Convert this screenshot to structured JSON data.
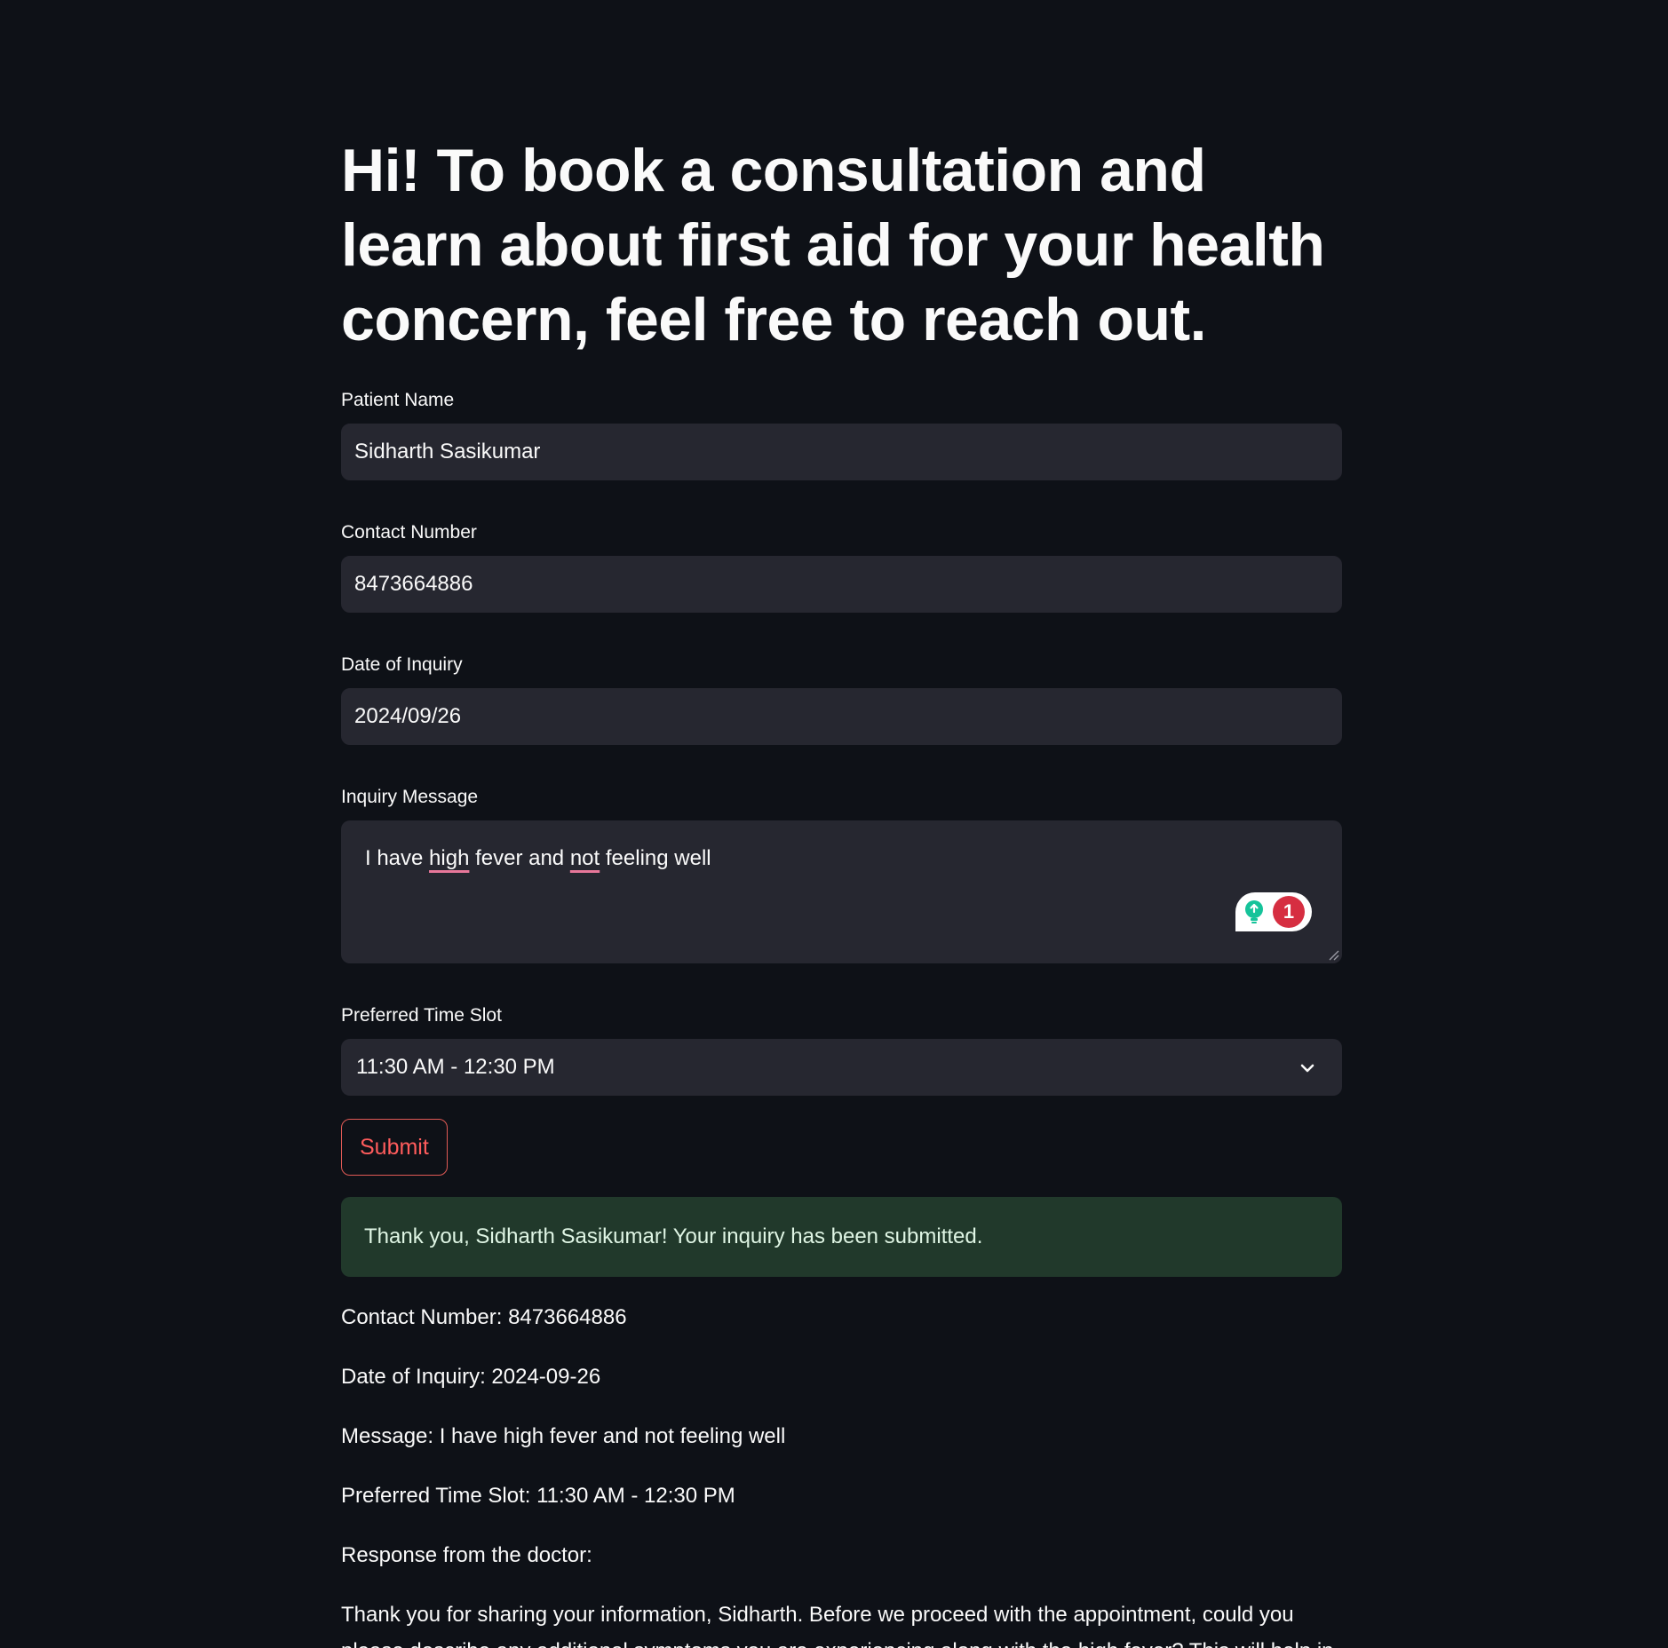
{
  "header": {
    "title": "Hi! To book a consultation and learn about first aid for your health concern, feel free to reach out."
  },
  "form": {
    "patient_name": {
      "label": "Patient Name",
      "value": "Sidharth Sasikumar"
    },
    "contact_number": {
      "label": "Contact Number",
      "value": "8473664886"
    },
    "date_of_inquiry": {
      "label": "Date of Inquiry",
      "value": "2024/09/26"
    },
    "inquiry_message": {
      "label": "Inquiry Message",
      "value": "I have high fever and not feeling well",
      "segments": {
        "a": "I have ",
        "b": "high",
        "c": " fever and ",
        "d": "not",
        "e": " feeling well"
      },
      "grammarly_count": "1"
    },
    "time_slot": {
      "label": "Preferred Time Slot",
      "value": "11:30 AM - 12:30 PM"
    },
    "submit_label": "Submit"
  },
  "result": {
    "success_message": "Thank you, Sidharth Sasikumar! Your inquiry has been submitted.",
    "contact_line": "Contact Number: 8473664886",
    "date_line": "Date of Inquiry: 2024-09-26",
    "message_line": "Message: I have high fever and not feeling well",
    "slot_line": "Preferred Time Slot: 11:30 AM - 12:30 PM",
    "response_heading": "Response from the doctor:",
    "doctor_response": "Thank you for sharing your information, Sidharth. Before we proceed with the appointment, could you please describe any additional symptoms you are experiencing along with the high fever? This will help in understanding your condition better."
  },
  "colors": {
    "background": "#0e1117",
    "input_bg": "#262730",
    "accent": "#ff4b4b",
    "success_bg": "#21392b",
    "grammarly_badge": "#d62e41",
    "grammarly_bulb": "#15c39a"
  },
  "icons": {
    "select_chevron": "chevron-down-icon",
    "grammarly": "grammarly-bulb-icon"
  }
}
